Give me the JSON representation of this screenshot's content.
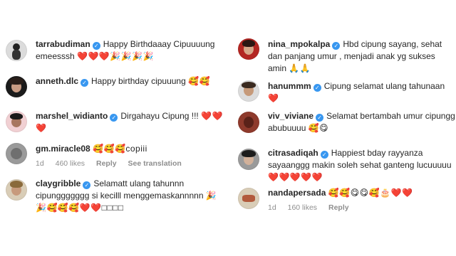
{
  "left_comments": [
    {
      "username": "tarrabudiman",
      "text": "Happy Birthdaaay Cipuuuung emeesssh",
      "emojis": "❤️❤️❤️🎉🎉🎉🎉",
      "likes": "",
      "age": "",
      "reply": "",
      "see_translation": ""
    },
    {
      "username": "anneth.dlc",
      "text": "Happy birthday cipuuung",
      "emojis": "🥰🥰",
      "likes": "",
      "age": "",
      "reply": "",
      "see_translation": ""
    },
    {
      "username": "marshel_widianto",
      "text": "Dirgahayu Cipung !!!",
      "emojis": "❤️❤️❤️",
      "likes": "",
      "age": "",
      "reply": "",
      "see_translation": ""
    },
    {
      "username": "gm.miracle08",
      "text": "",
      "emojis": "🥰🥰🥰copiii",
      "age": "1d",
      "likes": "460 likes",
      "reply": "Reply",
      "see_translation": "See translation"
    },
    {
      "username": "claygribble",
      "text": "Selamatt ulang tahunnn cipunggggggg si kecilll menggemaskannnnn",
      "emojis": "🎉🎉🥰🥰🥰❤️❤️□□□□",
      "likes": "",
      "age": "",
      "reply": "",
      "see_translation": ""
    }
  ],
  "right_comments": [
    {
      "username": "nina_mpokalpa",
      "text": "Hbd cipung sayang, sehat dan panjang umur , menjadi anak yg sukses amin",
      "emojis": "🙏🙏",
      "likes": "",
      "age": "",
      "reply": ""
    },
    {
      "username": "hanummm",
      "text": "Cipung selamat ulang tahunaan",
      "emojis": "❤️",
      "likes": "",
      "age": "",
      "reply": ""
    },
    {
      "username": "viv_viviane",
      "text": "Selamat bertambah umur cipungg abubuuuu",
      "emojis": "🥰😋",
      "likes": "",
      "age": "",
      "reply": ""
    },
    {
      "username": "citrasadiqah",
      "text": "Happiest bday rayyanza sayaanggg makin soleh sehat ganteng lucuuuuu",
      "emojis": "❤️❤️❤️❤️❤️",
      "likes": "",
      "age": "",
      "reply": ""
    },
    {
      "username": "nandapersada",
      "text": "",
      "emojis": "🥰🥰😋😋🥰🎂❤️❤️",
      "age": "1d",
      "likes": "160 likes",
      "reply": "Reply"
    }
  ]
}
